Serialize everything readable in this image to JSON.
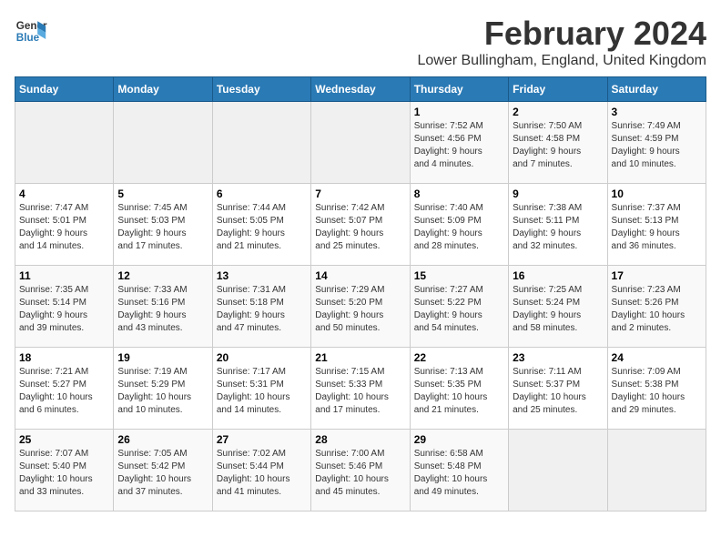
{
  "logo": {
    "line1": "General",
    "line2": "Blue"
  },
  "title": "February 2024",
  "subtitle": "Lower Bullingham, England, United Kingdom",
  "days_of_week": [
    "Sunday",
    "Monday",
    "Tuesday",
    "Wednesday",
    "Thursday",
    "Friday",
    "Saturday"
  ],
  "weeks": [
    [
      {
        "day": "",
        "info": ""
      },
      {
        "day": "",
        "info": ""
      },
      {
        "day": "",
        "info": ""
      },
      {
        "day": "",
        "info": ""
      },
      {
        "day": "1",
        "info": "Sunrise: 7:52 AM\nSunset: 4:56 PM\nDaylight: 9 hours\nand 4 minutes."
      },
      {
        "day": "2",
        "info": "Sunrise: 7:50 AM\nSunset: 4:58 PM\nDaylight: 9 hours\nand 7 minutes."
      },
      {
        "day": "3",
        "info": "Sunrise: 7:49 AM\nSunset: 4:59 PM\nDaylight: 9 hours\nand 10 minutes."
      }
    ],
    [
      {
        "day": "4",
        "info": "Sunrise: 7:47 AM\nSunset: 5:01 PM\nDaylight: 9 hours\nand 14 minutes."
      },
      {
        "day": "5",
        "info": "Sunrise: 7:45 AM\nSunset: 5:03 PM\nDaylight: 9 hours\nand 17 minutes."
      },
      {
        "day": "6",
        "info": "Sunrise: 7:44 AM\nSunset: 5:05 PM\nDaylight: 9 hours\nand 21 minutes."
      },
      {
        "day": "7",
        "info": "Sunrise: 7:42 AM\nSunset: 5:07 PM\nDaylight: 9 hours\nand 25 minutes."
      },
      {
        "day": "8",
        "info": "Sunrise: 7:40 AM\nSunset: 5:09 PM\nDaylight: 9 hours\nand 28 minutes."
      },
      {
        "day": "9",
        "info": "Sunrise: 7:38 AM\nSunset: 5:11 PM\nDaylight: 9 hours\nand 32 minutes."
      },
      {
        "day": "10",
        "info": "Sunrise: 7:37 AM\nSunset: 5:13 PM\nDaylight: 9 hours\nand 36 minutes."
      }
    ],
    [
      {
        "day": "11",
        "info": "Sunrise: 7:35 AM\nSunset: 5:14 PM\nDaylight: 9 hours\nand 39 minutes."
      },
      {
        "day": "12",
        "info": "Sunrise: 7:33 AM\nSunset: 5:16 PM\nDaylight: 9 hours\nand 43 minutes."
      },
      {
        "day": "13",
        "info": "Sunrise: 7:31 AM\nSunset: 5:18 PM\nDaylight: 9 hours\nand 47 minutes."
      },
      {
        "day": "14",
        "info": "Sunrise: 7:29 AM\nSunset: 5:20 PM\nDaylight: 9 hours\nand 50 minutes."
      },
      {
        "day": "15",
        "info": "Sunrise: 7:27 AM\nSunset: 5:22 PM\nDaylight: 9 hours\nand 54 minutes."
      },
      {
        "day": "16",
        "info": "Sunrise: 7:25 AM\nSunset: 5:24 PM\nDaylight: 9 hours\nand 58 minutes."
      },
      {
        "day": "17",
        "info": "Sunrise: 7:23 AM\nSunset: 5:26 PM\nDaylight: 10 hours\nand 2 minutes."
      }
    ],
    [
      {
        "day": "18",
        "info": "Sunrise: 7:21 AM\nSunset: 5:27 PM\nDaylight: 10 hours\nand 6 minutes."
      },
      {
        "day": "19",
        "info": "Sunrise: 7:19 AM\nSunset: 5:29 PM\nDaylight: 10 hours\nand 10 minutes."
      },
      {
        "day": "20",
        "info": "Sunrise: 7:17 AM\nSunset: 5:31 PM\nDaylight: 10 hours\nand 14 minutes."
      },
      {
        "day": "21",
        "info": "Sunrise: 7:15 AM\nSunset: 5:33 PM\nDaylight: 10 hours\nand 17 minutes."
      },
      {
        "day": "22",
        "info": "Sunrise: 7:13 AM\nSunset: 5:35 PM\nDaylight: 10 hours\nand 21 minutes."
      },
      {
        "day": "23",
        "info": "Sunrise: 7:11 AM\nSunset: 5:37 PM\nDaylight: 10 hours\nand 25 minutes."
      },
      {
        "day": "24",
        "info": "Sunrise: 7:09 AM\nSunset: 5:38 PM\nDaylight: 10 hours\nand 29 minutes."
      }
    ],
    [
      {
        "day": "25",
        "info": "Sunrise: 7:07 AM\nSunset: 5:40 PM\nDaylight: 10 hours\nand 33 minutes."
      },
      {
        "day": "26",
        "info": "Sunrise: 7:05 AM\nSunset: 5:42 PM\nDaylight: 10 hours\nand 37 minutes."
      },
      {
        "day": "27",
        "info": "Sunrise: 7:02 AM\nSunset: 5:44 PM\nDaylight: 10 hours\nand 41 minutes."
      },
      {
        "day": "28",
        "info": "Sunrise: 7:00 AM\nSunset: 5:46 PM\nDaylight: 10 hours\nand 45 minutes."
      },
      {
        "day": "29",
        "info": "Sunrise: 6:58 AM\nSunset: 5:48 PM\nDaylight: 10 hours\nand 49 minutes."
      },
      {
        "day": "",
        "info": ""
      },
      {
        "day": "",
        "info": ""
      }
    ]
  ]
}
